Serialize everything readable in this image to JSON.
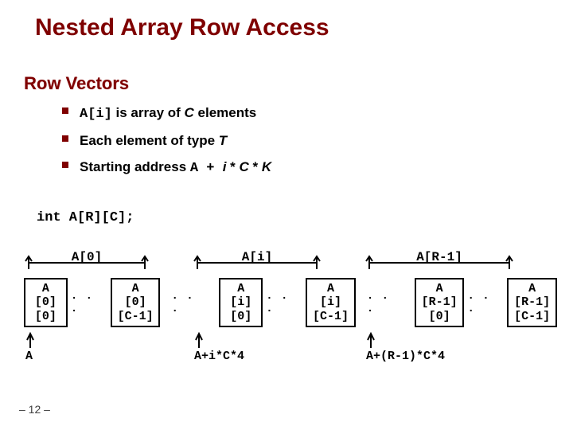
{
  "title": "Nested Array Row Access",
  "section": "Row Vectors",
  "bullets": {
    "b1_code": "A[i]",
    "b1_mid": " is array of ",
    "b1_C": "C",
    "b1_end": " elements",
    "b2_pre": "Each element of type ",
    "b2_T": "T",
    "b3_pre": "Starting address ",
    "b3_code": "A +  ",
    "b3_i": "i",
    "b3_mid": " * ",
    "b3_C": "C",
    "b3_mid2": " * ",
    "b3_K": "K"
  },
  "declaration": "int A[R][C];",
  "diagram": {
    "brackets": {
      "left": "A[0]",
      "mid": "A[i]",
      "right": "A[R-1]"
    },
    "boxes": {
      "g1a": [
        "A",
        "[0]",
        "[0]"
      ],
      "g1b": [
        "A",
        "[0]",
        "[C-1]"
      ],
      "g2a": [
        "A",
        "[i]",
        "[0]"
      ],
      "g2b": [
        "A",
        "[i]",
        "[C-1]"
      ],
      "g3a": [
        "A",
        "[R-1]",
        "[0]"
      ],
      "g3b": [
        "A",
        "[R-1]",
        "[C-1]"
      ]
    },
    "ellipsis": ". . .",
    "under": {
      "left": "A",
      "mid": "A+i*C*4",
      "right": "A+(R-1)*C*4"
    }
  },
  "footer": "– 12 –"
}
